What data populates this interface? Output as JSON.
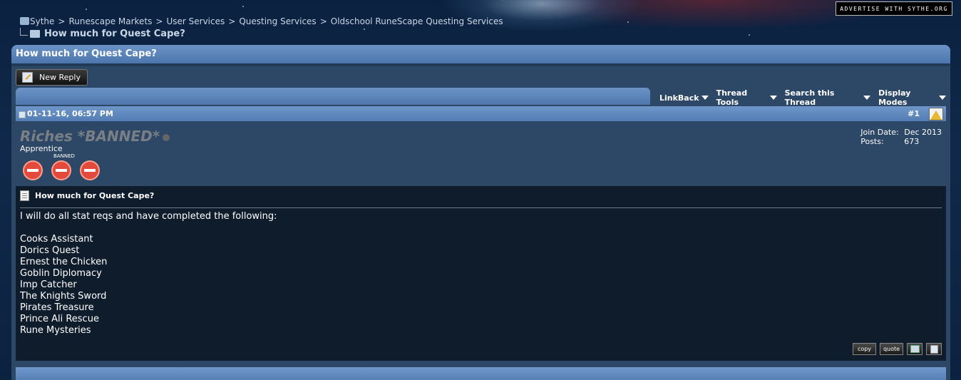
{
  "advertise_label": "Advertise with Sythe.org",
  "breadcrumb": {
    "items": [
      "Sythe",
      "Runescape Markets",
      "User Services",
      "Questing Services",
      "Oldschool RuneScape Questing Services"
    ],
    "separator": ">",
    "current": "How much for Quest Cape?"
  },
  "thread": {
    "title": "How much for Quest Cape?",
    "new_reply_label": "New Reply"
  },
  "tools": {
    "items": [
      "LinkBack",
      "Thread Tools",
      "Search this Thread",
      "Display Modes"
    ]
  },
  "post": {
    "date": "01-11-16, 06:57 PM",
    "number": "#1",
    "username": "Riches *BANNED*",
    "user_title": "Apprentice",
    "badge_label": "BANNED",
    "join_date_label": "Join Date:",
    "join_date": "Dec 2013",
    "posts_label": "Posts:",
    "posts": "673",
    "title": "How much for Quest Cape?",
    "intro": "I will do all stat reqs and have completed the following:",
    "quests": [
      "Cooks Assistant",
      "Dorics Quest",
      "Ernest the Chicken",
      "Goblin Diplomacy",
      "Imp Catcher",
      "The Knights Sword",
      "Pirates Treasure",
      "Prince Ali Rescue",
      "Rune Mysteries"
    ],
    "actions": {
      "copy_label": "copy",
      "quote_label": "quote"
    }
  },
  "colors": {
    "header_blue": "#5a82b8",
    "panel": "#2d4766",
    "post_body": "#0f1c2c",
    "banned_name": "#7a7f86"
  }
}
